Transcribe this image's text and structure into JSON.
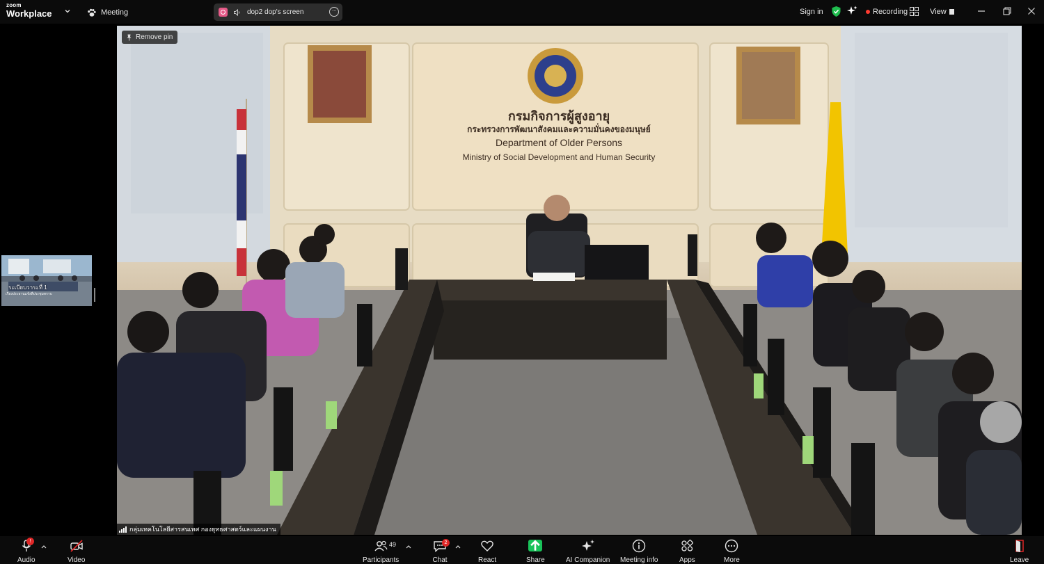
{
  "app": {
    "brand_small": "zoom",
    "brand_big": "Workplace"
  },
  "topbar": {
    "meeting_label": "Meeting",
    "share_title": "dop2 dop's screen",
    "more_glyph": "···",
    "sign_in": "Sign in",
    "recording": "Recording",
    "view": "View",
    "accent_green": "#1fbd4e",
    "recording_red": "#ff3b30"
  },
  "video": {
    "remove_pin": "Remove pin",
    "name_label": "กลุ่มเทคโนโลยีสารสนเทศ กองยุทธศาสตร์และแผนงาน",
    "wall_thai_title": "กรมกิจการผู้สูงอายุ",
    "wall_thai_sub": "กระทรวงการพัฒนาสังคมและความมั่นคงของมนุษย์",
    "wall_en_title": "Department of Older Persons",
    "wall_en_sub": "Ministry of Social Development and Human Security"
  },
  "thumbnail": {
    "label": "ระเบียบวาระที่ 1",
    "sublabel": "เรื่องประธานแจ้งที่ประชุมทราบ"
  },
  "toolbar": {
    "audio": "Audio",
    "audio_badge": "!",
    "video": "Video",
    "participants": "Participants",
    "participants_count": "49",
    "chat": "Chat",
    "chat_badge": "2",
    "react": "React",
    "share": "Share",
    "ai_companion": "AI Companion",
    "meeting_info": "Meeting info",
    "apps": "Apps",
    "more": "More",
    "leave": "Leave",
    "share_green": "#19c35a",
    "leave_red": "#e02828"
  }
}
